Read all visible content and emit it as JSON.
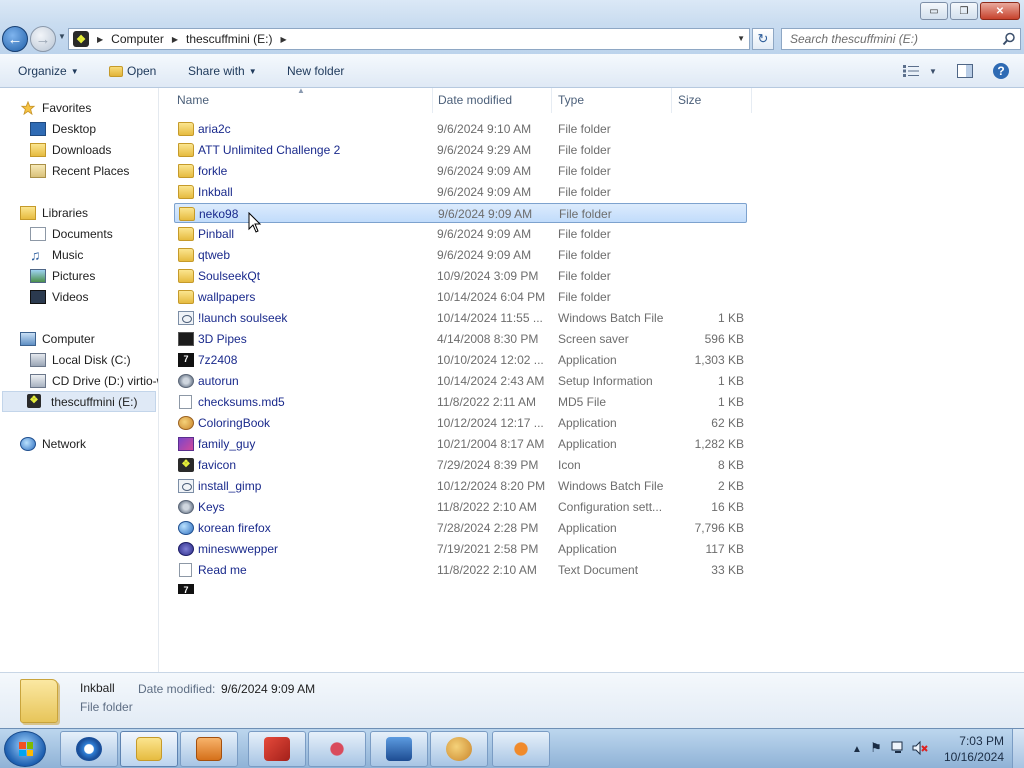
{
  "window": {
    "controls": {
      "minimize": "▭",
      "maximize": "❐",
      "close": "✕"
    }
  },
  "address": {
    "crumbs": [
      "Computer",
      "thescuffmini (E:)"
    ],
    "search_placeholder": "Search thescuffmini (E:)"
  },
  "toolbar": {
    "organize": "Organize",
    "open": "Open",
    "share_with": "Share with",
    "new_folder": "New folder"
  },
  "nav": {
    "favorites": "Favorites",
    "desktop": "Desktop",
    "downloads": "Downloads",
    "recent_places": "Recent Places",
    "libraries": "Libraries",
    "documents": "Documents",
    "music": "Music",
    "pictures": "Pictures",
    "videos": "Videos",
    "computer": "Computer",
    "local_disk": "Local Disk (C:)",
    "cd_drive": "CD Drive (D:) virtio-w",
    "thescuffmini": "thescuffmini (E:)",
    "network": "Network"
  },
  "columns": {
    "name": "Name",
    "date": "Date modified",
    "type": "Type",
    "size": "Size"
  },
  "files": [
    {
      "name": "aria2c",
      "date": "9/6/2024 9:10 AM",
      "type": "File folder",
      "size": "",
      "icon": "folder"
    },
    {
      "name": "ATT Unlimited Challenge 2",
      "date": "9/6/2024 9:29 AM",
      "type": "File folder",
      "size": "",
      "icon": "folder"
    },
    {
      "name": "forkle",
      "date": "9/6/2024 9:09 AM",
      "type": "File folder",
      "size": "",
      "icon": "folder"
    },
    {
      "name": "Inkball",
      "date": "9/6/2024 9:09 AM",
      "type": "File folder",
      "size": "",
      "icon": "folder"
    },
    {
      "name": "neko98",
      "date": "9/6/2024 9:09 AM",
      "type": "File folder",
      "size": "",
      "icon": "folder"
    },
    {
      "name": "Pinball",
      "date": "9/6/2024 9:09 AM",
      "type": "File folder",
      "size": "",
      "icon": "folder"
    },
    {
      "name": "qtweb",
      "date": "9/6/2024 9:09 AM",
      "type": "File folder",
      "size": "",
      "icon": "folder"
    },
    {
      "name": "SoulseekQt",
      "date": "10/9/2024 3:09 PM",
      "type": "File folder",
      "size": "",
      "icon": "folder"
    },
    {
      "name": "wallpapers",
      "date": "10/14/2024 6:04 PM",
      "type": "File folder",
      "size": "",
      "icon": "folder"
    },
    {
      "name": "!launch soulseek",
      "date": "10/14/2024 11:55 ...",
      "type": "Windows Batch File",
      "size": "1 KB",
      "icon": "batch"
    },
    {
      "name": "3D Pipes",
      "date": "4/14/2008 8:30 PM",
      "type": "Screen saver",
      "size": "596 KB",
      "icon": "screen"
    },
    {
      "name": "7z2408",
      "date": "10/10/2024 12:02 ...",
      "type": "Application",
      "size": "1,303 KB",
      "icon": "z7"
    },
    {
      "name": "autorun",
      "date": "10/14/2024 2:43 AM",
      "type": "Setup Information",
      "size": "1 KB",
      "icon": "gear"
    },
    {
      "name": "checksums.md5",
      "date": "11/8/2022 2:11 AM",
      "type": "MD5 File",
      "size": "1 KB",
      "icon": "doc"
    },
    {
      "name": "ColoringBook",
      "date": "10/12/2024 12:17 ...",
      "type": "Application",
      "size": "62 KB",
      "icon": "palette"
    },
    {
      "name": "family_guy",
      "date": "10/21/2004 8:17 AM",
      "type": "Application",
      "size": "1,282 KB",
      "icon": "fam"
    },
    {
      "name": "favicon",
      "date": "7/29/2024 8:39 PM",
      "type": "Icon",
      "size": "8 KB",
      "icon": "fav"
    },
    {
      "name": "install_gimp",
      "date": "10/12/2024 8:20 PM",
      "type": "Windows Batch File",
      "size": "2 KB",
      "icon": "batch"
    },
    {
      "name": "Keys",
      "date": "11/8/2022 2:10 AM",
      "type": "Configuration sett...",
      "size": "16 KB",
      "icon": "gear"
    },
    {
      "name": "korean firefox",
      "date": "7/28/2024 2:28 PM",
      "type": "Application",
      "size": "7,796 KB",
      "icon": "globe"
    },
    {
      "name": "mineswwepper",
      "date": "7/19/2021 2:58 PM",
      "type": "Application",
      "size": "117 KB",
      "icon": "mine"
    },
    {
      "name": "Read me",
      "date": "11/8/2022 2:10 AM",
      "type": "Text Document",
      "size": "33 KB",
      "icon": "doc"
    }
  ],
  "details": {
    "name": "Inkball",
    "modified_label": "Date modified:",
    "modified_value": "9/6/2024 9:09 AM",
    "type": "File folder"
  },
  "taskbar": {
    "time": "7:03 PM",
    "date": "10/16/2024"
  }
}
